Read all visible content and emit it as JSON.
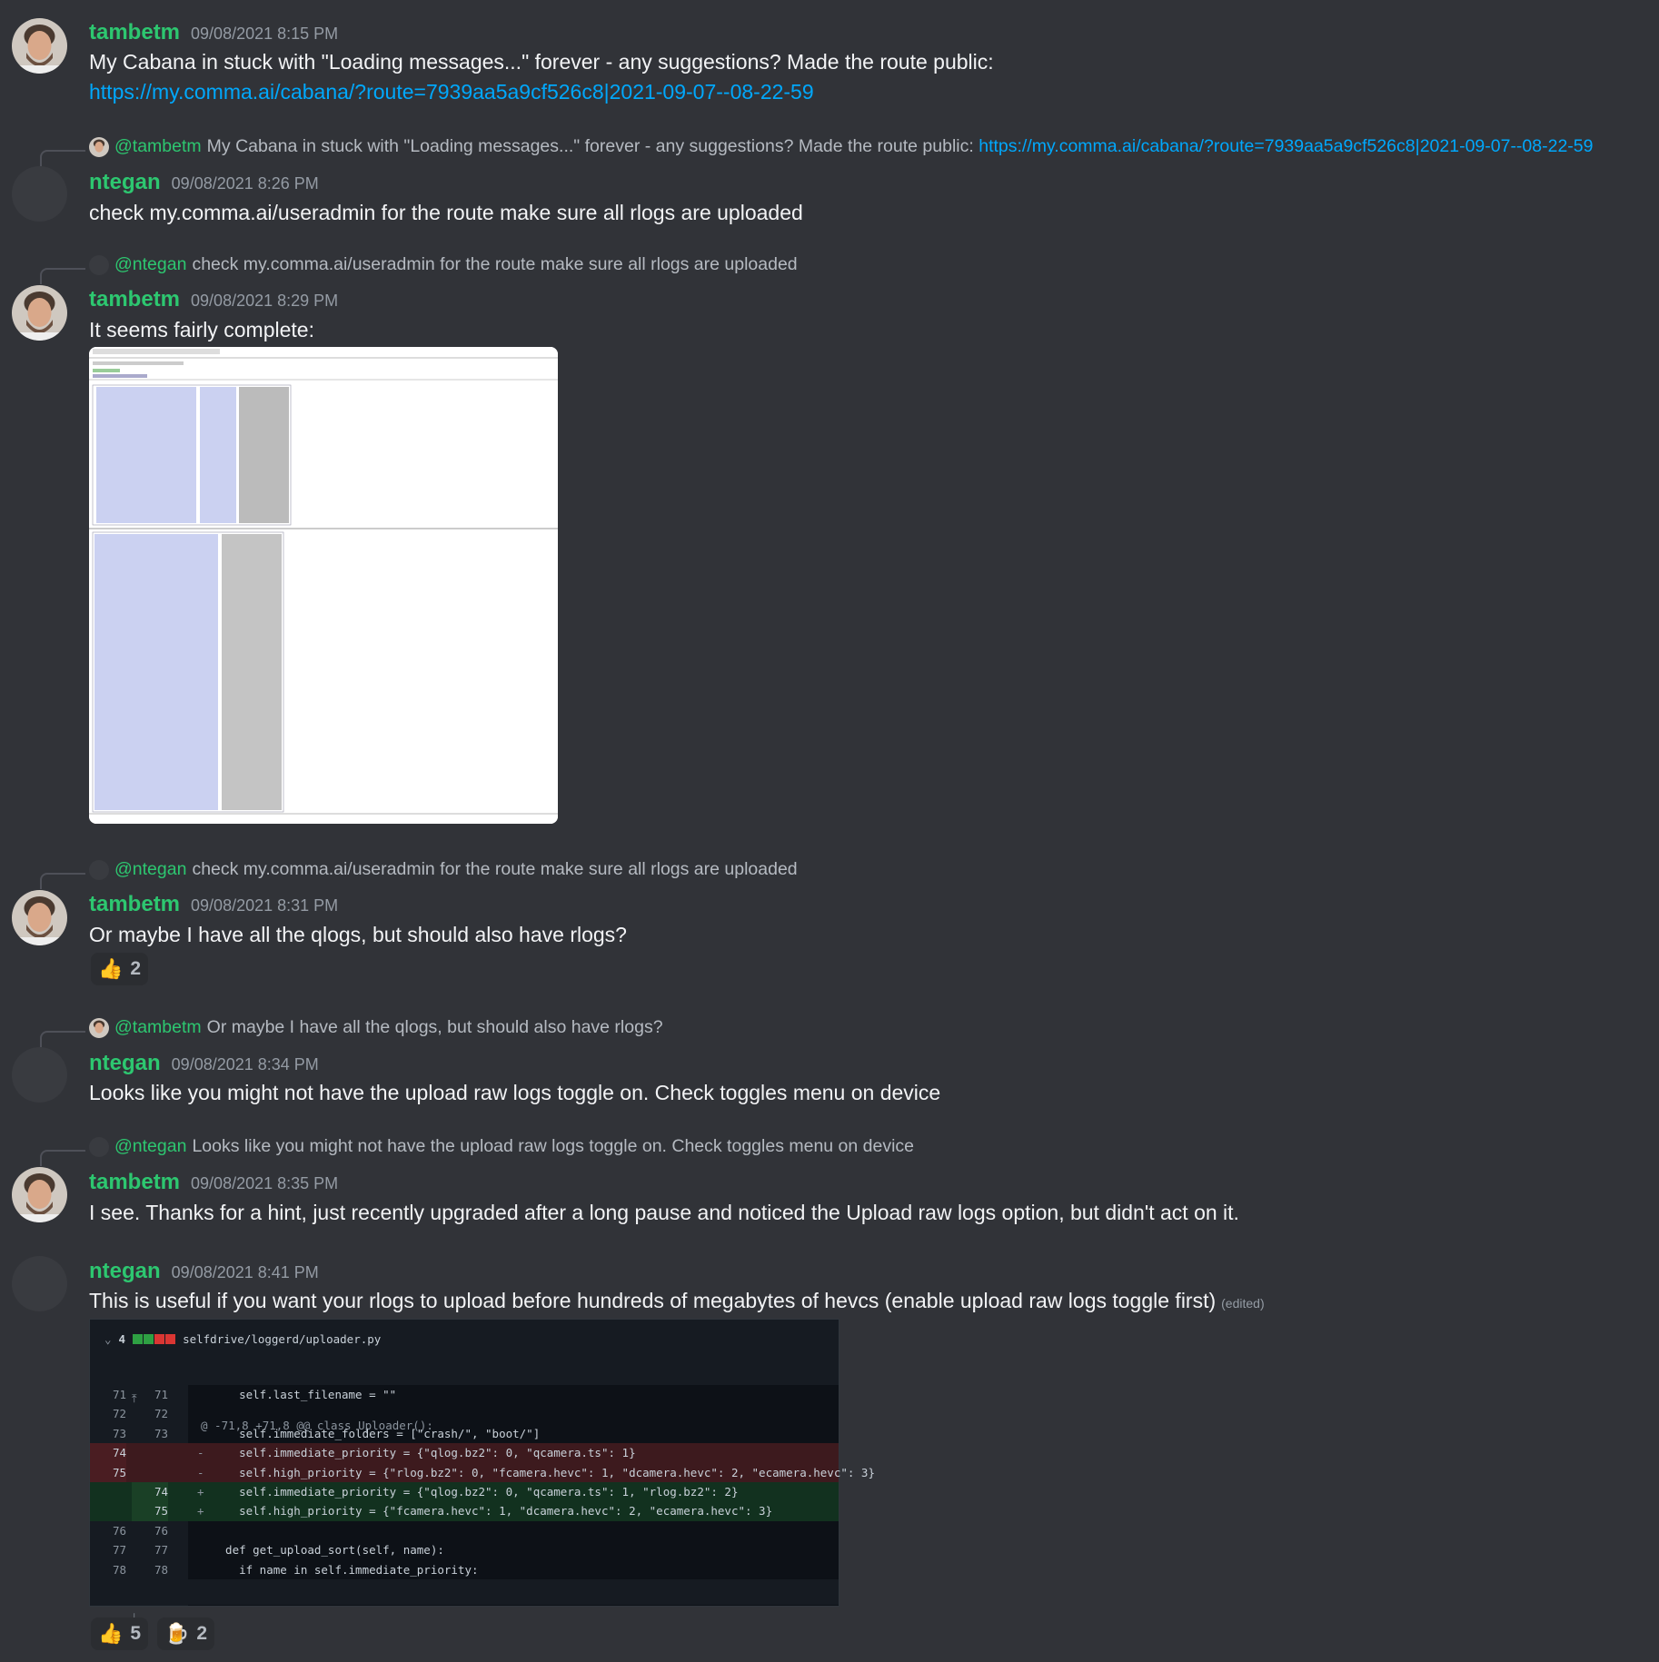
{
  "messages": [
    {
      "author": "tambetm",
      "time": "09/08/2021 8:15 PM",
      "text": "My Cabana in stuck with \"Loading messages...\" forever - any suggestions? Made the route public:",
      "link": "https://my.comma.ai/cabana/?route=7939aa5a9cf526c8|2021-09-07--08-22-59"
    },
    {
      "reply_mention": "@tambetm",
      "reply_text": "My Cabana in stuck with \"Loading messages...\" forever - any suggestions? Made the route public:",
      "reply_link": "https://my.comma.ai/cabana/?route=7939aa5a9cf526c8|2021-09-07--08-22-59",
      "author": "ntegan",
      "time": "09/08/2021 8:26 PM",
      "text": "check my.comma.ai/useradmin for the route make sure all rlogs are uploaded"
    },
    {
      "reply_mention": "@ntegan",
      "reply_text": "check my.comma.ai/useradmin for the route make sure all rlogs are uploaded",
      "author": "tambetm",
      "time": "09/08/2021 8:29 PM",
      "text": "It seems fairly complete:"
    },
    {
      "reply_mention": "@ntegan",
      "reply_text": "check my.comma.ai/useradmin for the route make sure all rlogs are uploaded",
      "author": "tambetm",
      "time": "09/08/2021 8:31 PM",
      "text": "Or maybe I have all the qlogs, but should also have rlogs?",
      "reaction": {
        "emoji": "👍",
        "count": "2"
      }
    },
    {
      "reply_mention": "@tambetm",
      "reply_text": "Or maybe I have all the qlogs, but should also have rlogs?",
      "author": "ntegan",
      "time": "09/08/2021 8:34 PM",
      "text": "Looks like you might not have the upload raw logs toggle on. Check toggles menu on device"
    },
    {
      "reply_mention": "@ntegan",
      "reply_text": "Looks like you might not have the upload raw logs toggle on. Check toggles menu on device",
      "author": "tambetm",
      "time": "09/08/2021 8:35 PM",
      "text": "I see. Thanks for a hint, just recently upgraded after a long pause and noticed the Upload raw logs option, but didn't act on it."
    },
    {
      "author": "ntegan",
      "time": "09/08/2021 8:41 PM",
      "text": "This is useful if you want your rlogs to upload before hundreds of megabytes of hevcs (enable upload raw logs toggle first)",
      "edited": "(edited)",
      "reactions": [
        {
          "emoji": "👍",
          "count": "5"
        },
        {
          "emoji": "🍺",
          "count": "2"
        }
      ]
    }
  ],
  "diff": {
    "count": "4",
    "file": "selfdrive/loggerd/uploader.py",
    "hunk": "@ -71,8 +71,8 @@ class Uploader():",
    "rows": [
      {
        "type": "ctx",
        "l1": "71",
        "l2": "71",
        "sign": "",
        "code": "    self.last_filename = \"\""
      },
      {
        "type": "ctx",
        "l1": "72",
        "l2": "72",
        "sign": "",
        "code": ""
      },
      {
        "type": "ctx",
        "l1": "73",
        "l2": "73",
        "sign": "",
        "code": "    self.immediate_folders = [\"crash/\", \"boot/\"]"
      },
      {
        "type": "del",
        "l1": "74",
        "l2": "",
        "sign": "-",
        "code": "    self.immediate_priority = {\"qlog.bz2\": 0, \"qcamera.ts\": 1}"
      },
      {
        "type": "del",
        "l1": "75",
        "l2": "",
        "sign": "-",
        "code": "    self.high_priority = {\"rlog.bz2\": 0, \"fcamera.hevc\": 1, \"dcamera.hevc\": 2, \"ecamera.hevc\": 3}"
      },
      {
        "type": "add",
        "l1": "",
        "l2": "74",
        "sign": "+",
        "code": "    self.immediate_priority = {\"qlog.bz2\": 0, \"qcamera.ts\": 1, \"rlog.bz2\": 2}"
      },
      {
        "type": "add",
        "l1": "",
        "l2": "75",
        "sign": "+",
        "code": "    self.high_priority = {\"fcamera.hevc\": 1, \"dcamera.hevc\": 2, \"ecamera.hevc\": 3}"
      },
      {
        "type": "ctx",
        "l1": "76",
        "l2": "76",
        "sign": "",
        "code": ""
      },
      {
        "type": "ctx",
        "l1": "77",
        "l2": "77",
        "sign": "",
        "code": "  def get_upload_sort(self, name):"
      },
      {
        "type": "ctx",
        "l1": "78",
        "l2": "78",
        "sign": "",
        "code": "    if name in self.immediate_priority:"
      }
    ],
    "expand_up": "⤒",
    "expand_down": "⤓"
  },
  "colors": {
    "accent_name": "#2dc770",
    "link": "#00a8fc",
    "background": "#313338"
  }
}
